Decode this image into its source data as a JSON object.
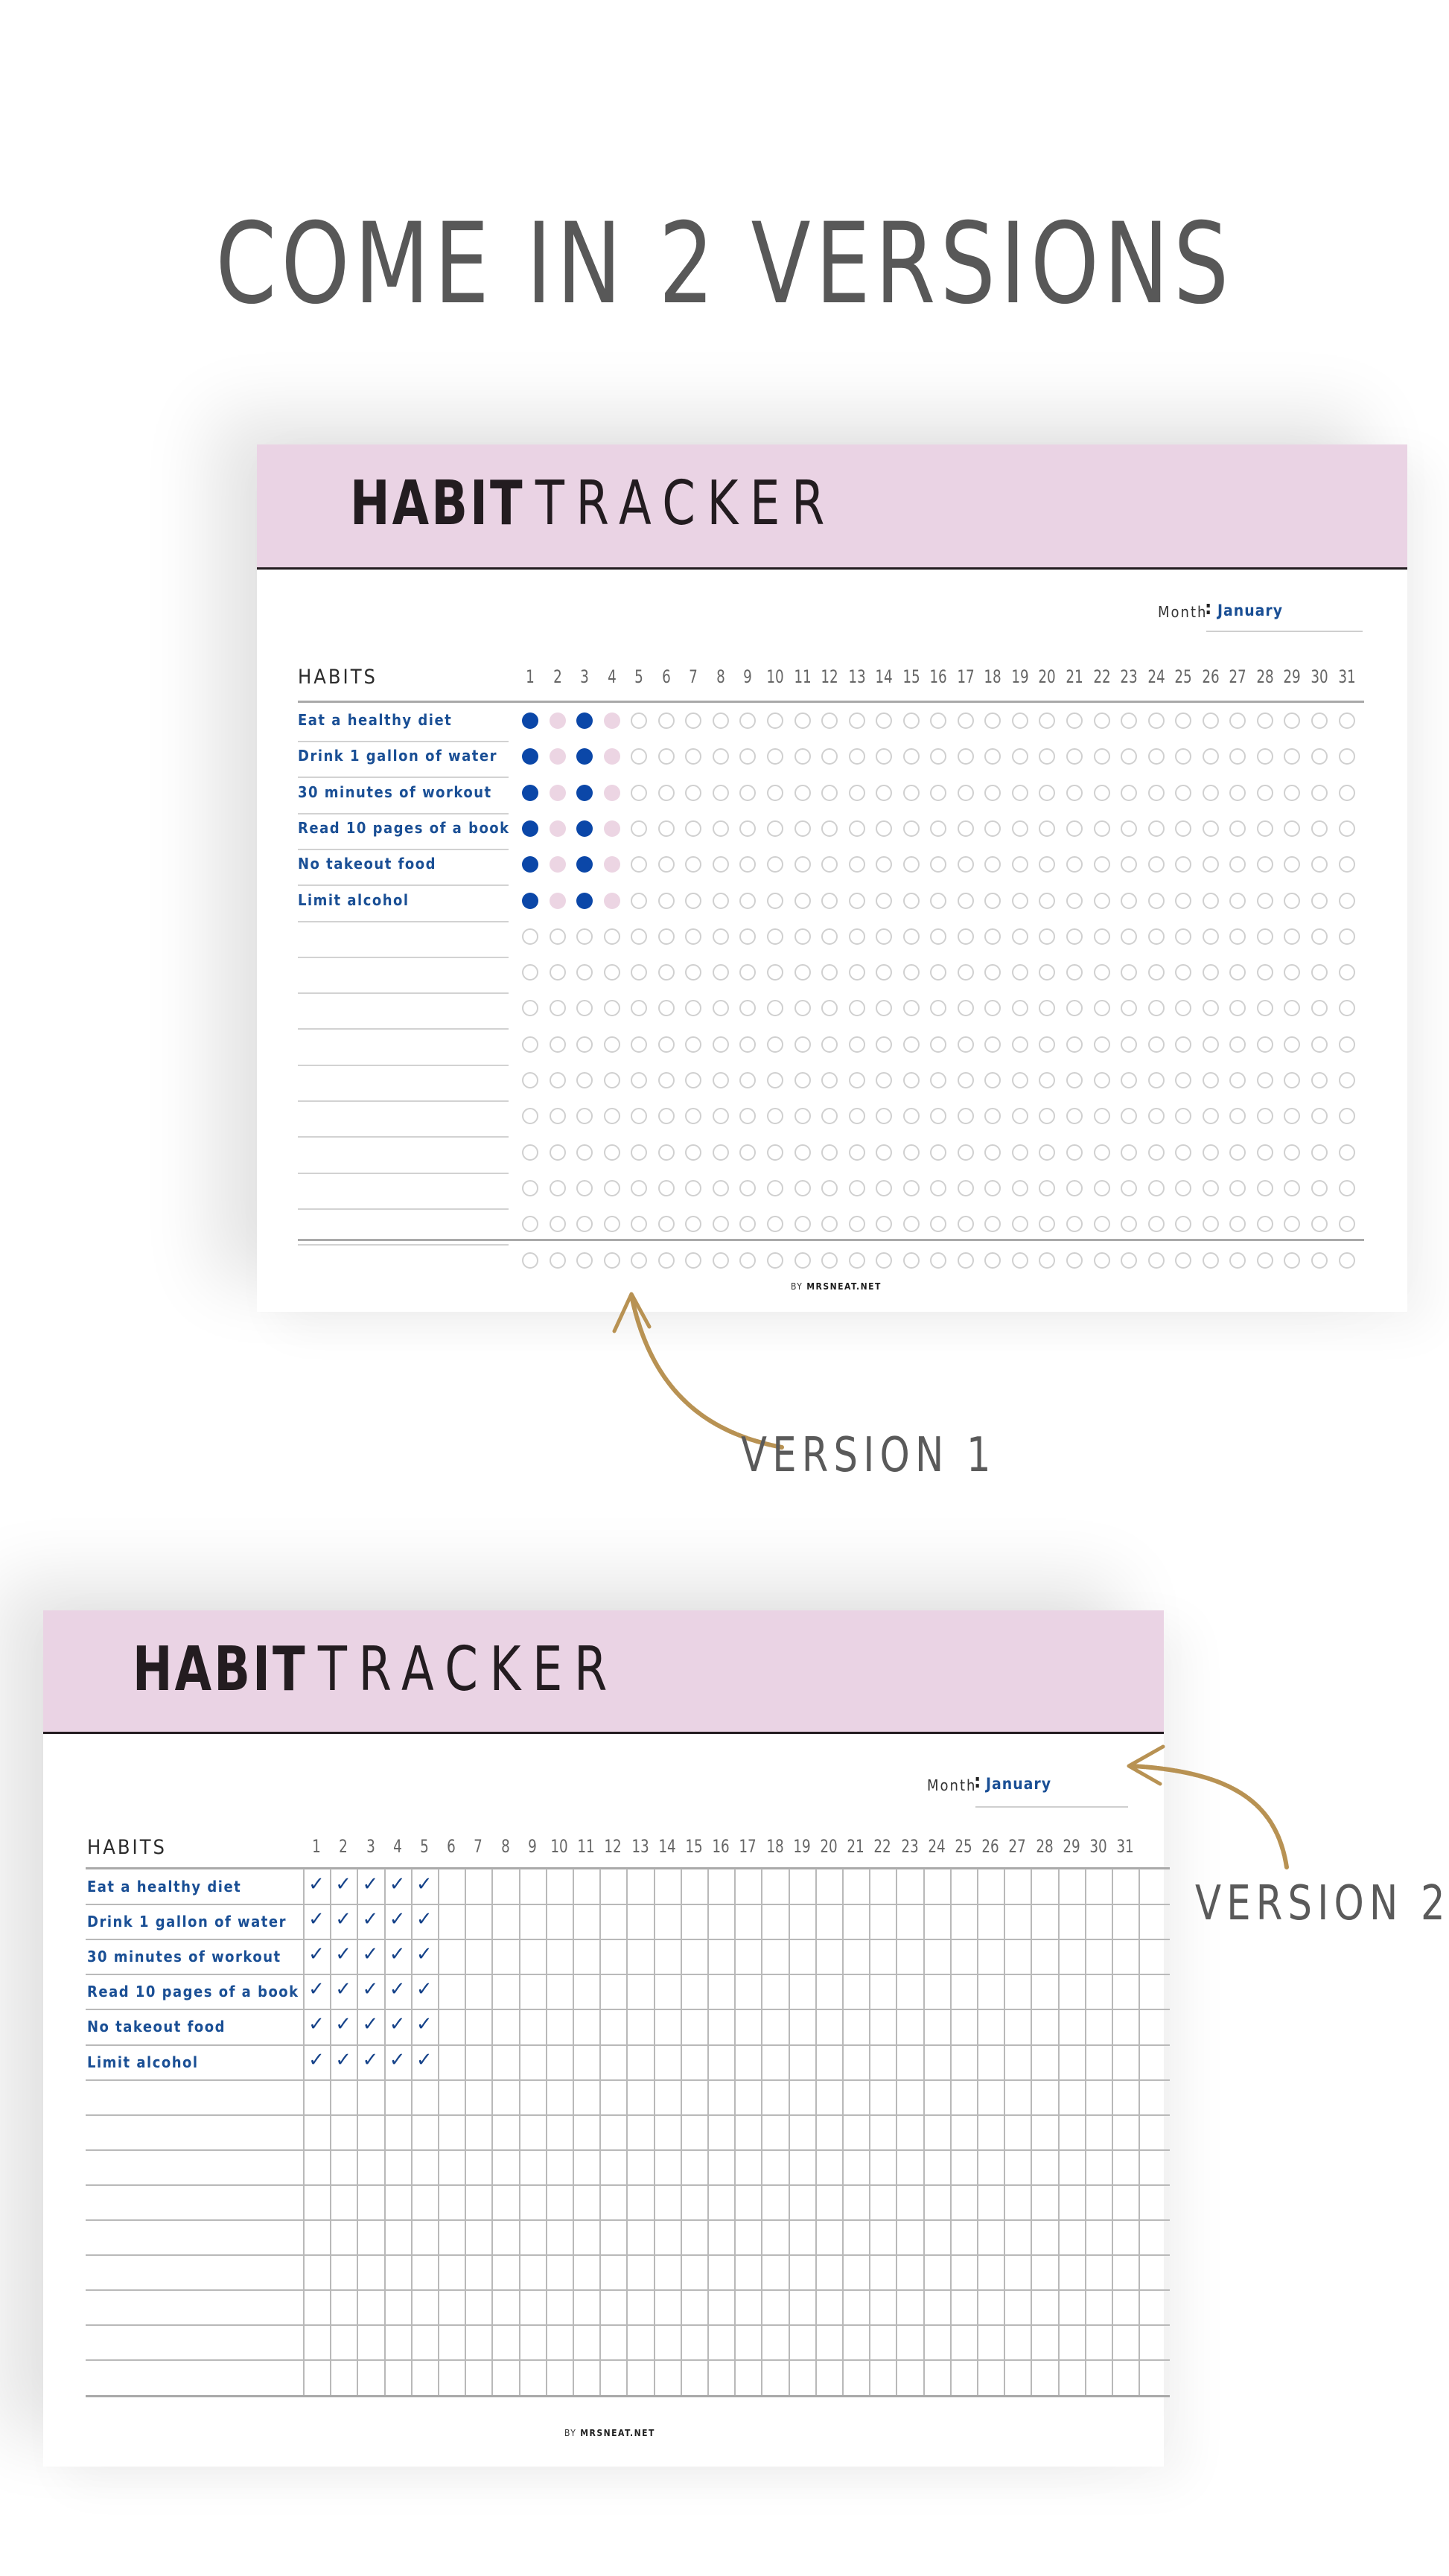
{
  "page_title": "COME IN 2 VERSIONS",
  "colors": {
    "header_pink": "#ead3e4",
    "habit_blue": "#1a4f95",
    "dot_blue": "#0b47a8",
    "dot_pink": "#ecd5e3",
    "arrow_gold": "#b89253",
    "title_gray": "#585858"
  },
  "version1": {
    "label": "VERSION 1",
    "title_bold": "HABIT",
    "title_light": "TRACKER",
    "month_label": "Month",
    "month_value": "January",
    "habits_heading": "HABITS",
    "days": [
      1,
      2,
      3,
      4,
      5,
      6,
      7,
      8,
      9,
      10,
      11,
      12,
      13,
      14,
      15,
      16,
      17,
      18,
      19,
      20,
      21,
      22,
      23,
      24,
      25,
      26,
      27,
      28,
      29,
      30,
      31
    ],
    "habits": [
      "Eat a healthy diet",
      "Drink 1 gallon of water",
      "30 minutes of workout",
      "Read 10 pages of a book",
      "No takeout food",
      "Limit alcohol",
      "",
      "",
      "",
      "",
      "",
      "",
      "",
      "",
      "",
      ""
    ],
    "marker_style": "circles",
    "day_states_first_rows": [
      "full",
      "partial",
      "full",
      "partial"
    ],
    "filled_rows": 6,
    "credit_prefix": "BY",
    "credit_brand": "MRSNEAT.NET"
  },
  "version2": {
    "label": "VERSION 2",
    "title_bold": "HABIT",
    "title_light": "TRACKER",
    "month_label": "Month",
    "month_value": "January",
    "habits_heading": "HABITS",
    "days": [
      1,
      2,
      3,
      4,
      5,
      6,
      7,
      8,
      9,
      10,
      11,
      12,
      13,
      14,
      15,
      16,
      17,
      18,
      19,
      20,
      21,
      22,
      23,
      24,
      25,
      26,
      27,
      28,
      29,
      30,
      31
    ],
    "habits": [
      "Eat a healthy diet",
      "Drink 1 gallon of water",
      "30 minutes of workout",
      "Read 10 pages of a book",
      "No takeout food",
      "Limit alcohol",
      "",
      "",
      "",
      "",
      "",
      "",
      "",
      "",
      ""
    ],
    "marker_style": "checkmarks",
    "checked_days": 5,
    "filled_rows": 6,
    "check_glyph": "✓",
    "credit_prefix": "BY",
    "credit_brand": "MRSNEAT.NET"
  }
}
